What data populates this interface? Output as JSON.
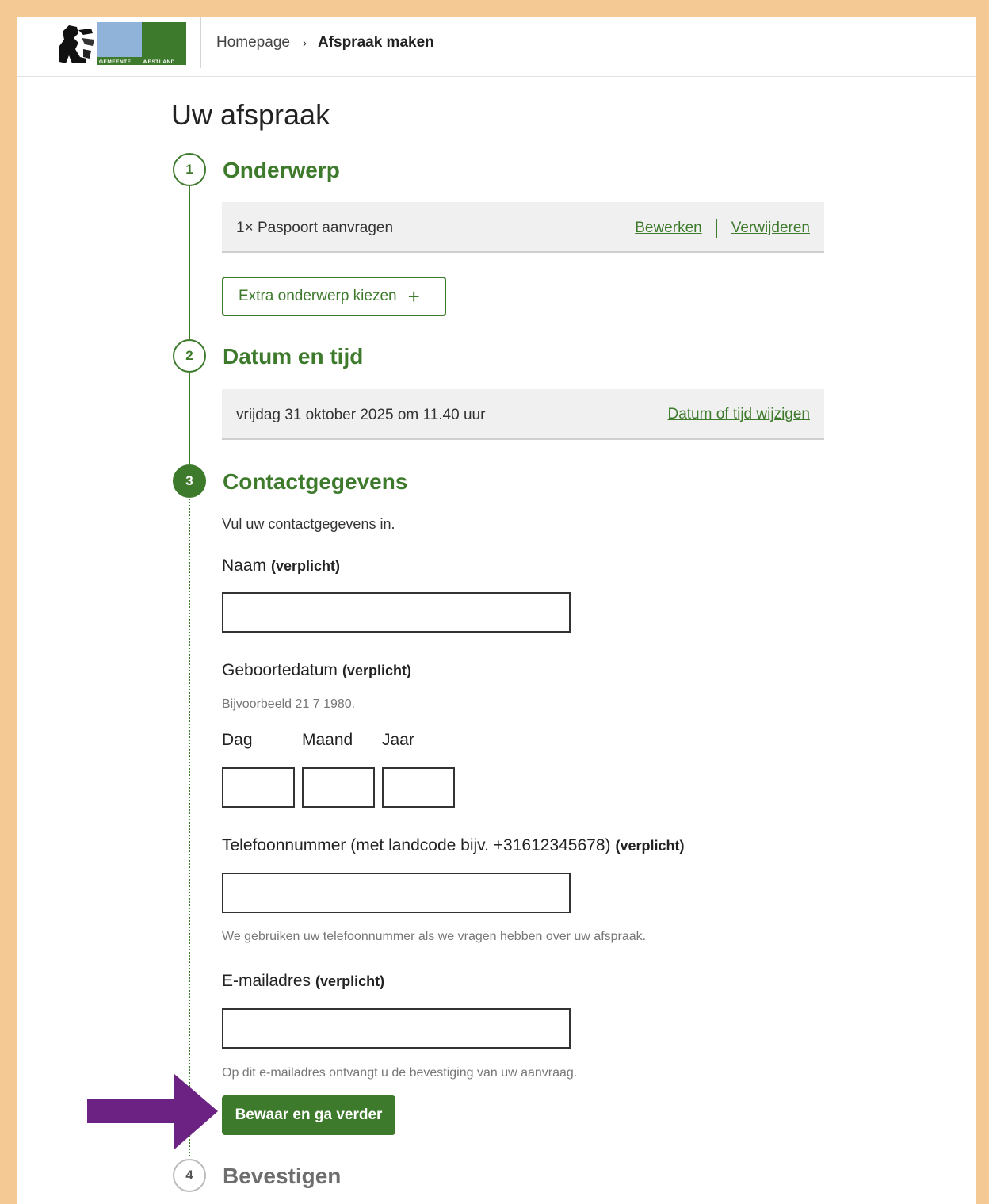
{
  "header": {
    "logo_alt": "GEMEENTE WESTLAND",
    "breadcrumb": {
      "home": "Homepage",
      "separator": "›",
      "current": "Afspraak maken"
    }
  },
  "page_title": "Uw afspraak",
  "steps": [
    {
      "number": "1",
      "title": "Onderwerp"
    },
    {
      "number": "2",
      "title": "Datum en tijd"
    },
    {
      "number": "3",
      "title": "Contactgegevens"
    },
    {
      "number": "4",
      "title": "Bevestigen"
    }
  ],
  "onderwerp": {
    "item": "1× Paspoort aanvragen",
    "edit_label": "Bewerken",
    "delete_label": "Verwijderen",
    "add_label": "Extra onderwerp kiezen",
    "add_icon": "+"
  },
  "datum": {
    "value": "vrijdag 31 oktober 2025 om 11.40 uur",
    "change_label": "Datum of tijd wijzigen"
  },
  "contact": {
    "intro": "Vul uw contactgegevens in.",
    "required_label": "(verplicht)",
    "naam_label": "Naam",
    "geboortedatum_label": "Geboortedatum",
    "geboortedatum_hint": "Bijvoorbeeld 21 7 1980.",
    "dag_label": "Dag",
    "maand_label": "Maand",
    "jaar_label": "Jaar",
    "telefoon_label": "Telefoonnummer (met landcode bijv. +31612345678)",
    "telefoon_hint": "We gebruiken uw telefoonnummer als we vragen hebben over uw afspraak.",
    "email_label": "E-mailadres",
    "email_hint": "Op dit e-mailadres ontvangt u de bevestiging van uw aanvraag.",
    "submit_label": "Bewaar en ga verder"
  },
  "colors": {
    "accent": "#3e7a2c",
    "frame": "#f5c993",
    "annotation_arrow": "#6b2283"
  }
}
